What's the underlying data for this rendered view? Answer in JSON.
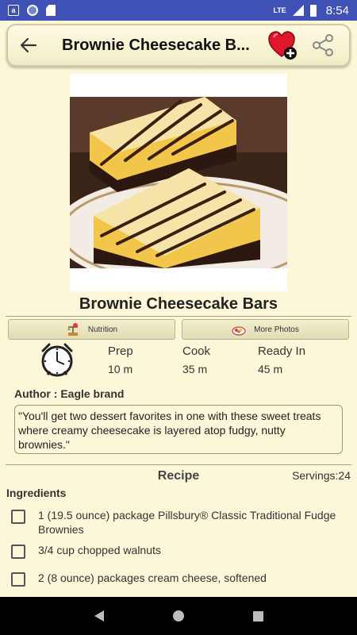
{
  "status_bar": {
    "left_icons": [
      "a",
      "",
      ""
    ],
    "network": "LTE",
    "time": "8:54"
  },
  "app_bar": {
    "title": "Brownie Cheesecake B...",
    "back_icon": "arrow-left-icon",
    "favorite_icon": "heart-plus-icon",
    "share_icon": "share-icon"
  },
  "recipe": {
    "title": "Brownie Cheesecake Bars",
    "image_icon": "recipe-photo"
  },
  "tabs": {
    "nutrition": "Nutrition",
    "more_photos": "More Photos"
  },
  "times": [
    {
      "label": "Prep",
      "value": "10 m"
    },
    {
      "label": "Cook",
      "value": "35 m"
    },
    {
      "label": "Ready In",
      "value": "45 m"
    }
  ],
  "author": "Author : Eagle brand",
  "description": "\"You'll get two dessert favorites in one with these sweet treats where creamy cheesecake is layered atop fudgy, nutty brownies.\"",
  "recipe_section": {
    "heading": "Recipe",
    "servings": "Servings:24",
    "ingredients_heading": "Ingredients",
    "ingredients": [
      "1 (19.5 ounce) package Pillsbury® Classic Traditional Fudge Brownies",
      "3/4 cup chopped walnuts",
      "2 (8 ounce) packages cream cheese, softened"
    ]
  },
  "colors": {
    "status_bar": "#3f51b5",
    "background": "#fbf7d8",
    "nav_bar": "#000000"
  }
}
